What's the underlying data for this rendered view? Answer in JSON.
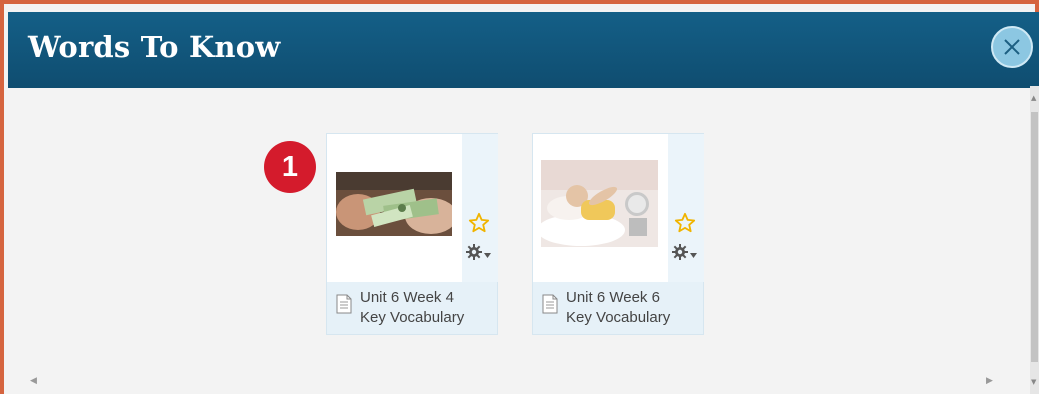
{
  "dialog": {
    "title": "Words To Know",
    "close_icon": "close-icon"
  },
  "step_badge": "1",
  "cards": [
    {
      "label_line1": "Unit 6 Week 4",
      "label_line2": "Key Vocabulary",
      "image": "money-exchange-photo",
      "star_icon": "star-outline-icon",
      "gear_icon": "gear-dropdown-icon",
      "doc_icon": "document-icon"
    },
    {
      "label_line1": "Unit 6 Week 6",
      "label_line2": "Key Vocabulary",
      "image": "sleeping-child-alarm-clock-photo",
      "star_icon": "star-outline-icon",
      "gear_icon": "gear-dropdown-icon",
      "doc_icon": "document-icon"
    }
  ],
  "colors": {
    "titlebar": "#135c83",
    "border": "#d5643f",
    "badge": "#d41b2c",
    "star": "#f0b400",
    "close_button": "#8cc7e2"
  }
}
